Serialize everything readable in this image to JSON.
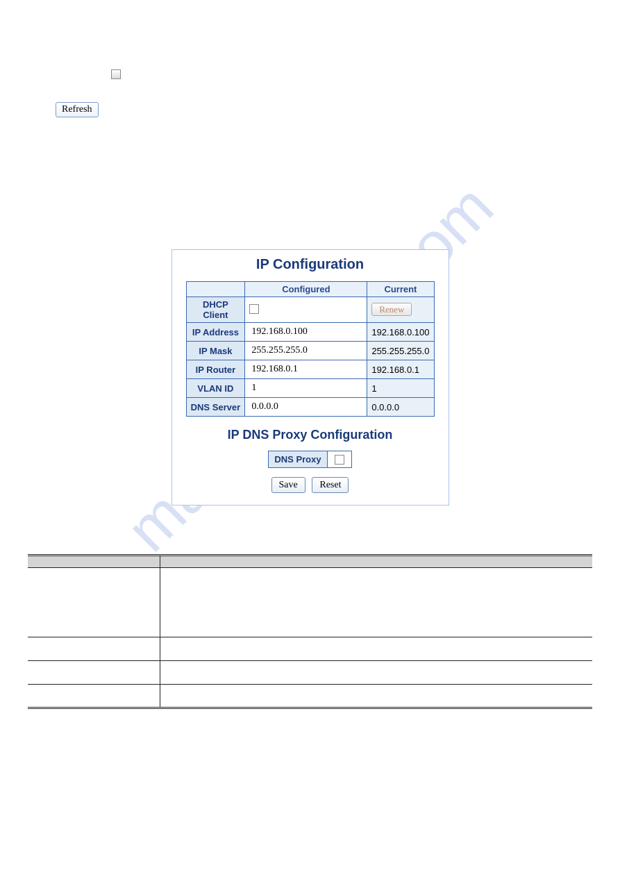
{
  "top": {
    "refresh": "Refresh"
  },
  "panel": {
    "title": "IP Configuration",
    "headers": {
      "blank": "",
      "configured": "Configured",
      "current": "Current"
    },
    "rows": {
      "dhcp": {
        "label": "DHCP Client",
        "renew": "Renew"
      },
      "ip_address": {
        "label": "IP Address",
        "configured": "192.168.0.100",
        "current": "192.168.0.100"
      },
      "ip_mask": {
        "label": "IP Mask",
        "configured": "255.255.255.0",
        "current": "255.255.255.0"
      },
      "ip_router": {
        "label": "IP Router",
        "configured": "192.168.0.1",
        "current": "192.168.0.1"
      },
      "vlan_id": {
        "label": "VLAN ID",
        "configured": "1",
        "current": "1"
      },
      "dns_server": {
        "label": "DNS Server",
        "configured": "0.0.0.0",
        "current": "0.0.0.0"
      }
    },
    "subtitle": "IP DNS Proxy Configuration",
    "dns_proxy_label": "DNS Proxy",
    "save": "Save",
    "reset": "Reset"
  }
}
